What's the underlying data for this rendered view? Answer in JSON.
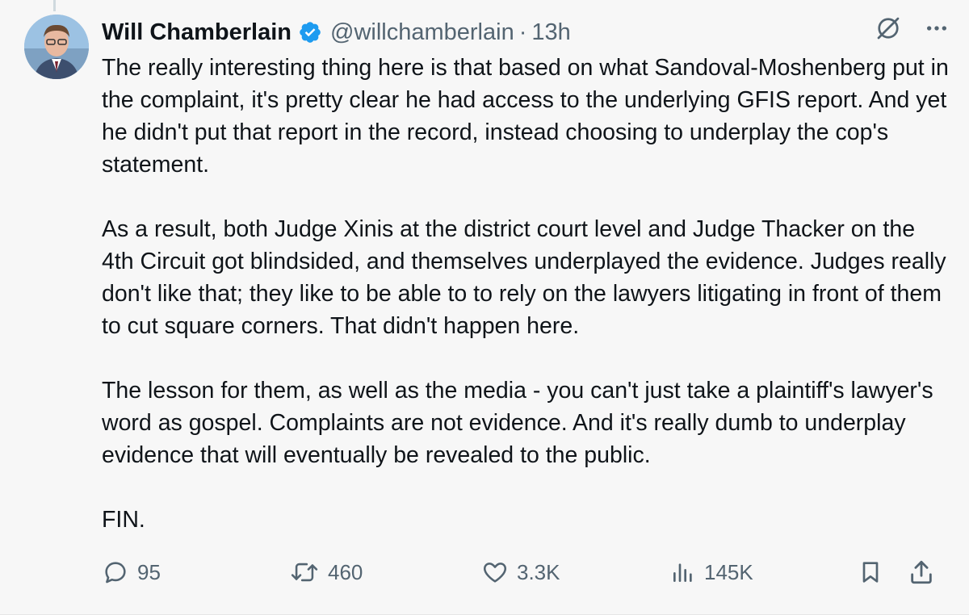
{
  "author": {
    "name": "Will Chamberlain",
    "handle": "@willchamberlain",
    "separator": "·",
    "time": "13h",
    "verified": true,
    "verified_color": "#1d9bf0"
  },
  "post": {
    "paragraphs": [
      "The really interesting thing here is that based on what Sandoval-Moshenberg put in the complaint, it's pretty clear he had access to the underlying GFIS report. And yet he didn't put that report in the record, instead choosing to underplay the cop's statement.",
      "As a result, both Judge Xinis at the district court level and Judge Thacker on the 4th Circuit got blindsided, and themselves underplayed the evidence. Judges really don't like that; they like to be able to to rely on the lawyers litigating in front of them to cut square corners. That didn't happen here.",
      "The lesson for them, as well as the media - you can't just take a plaintiff's lawyer's word as gospel. Complaints are not evidence. And it's really dumb to underplay evidence that will eventually be revealed to the public.",
      "FIN."
    ]
  },
  "actions": {
    "replies": "95",
    "reposts": "460",
    "likes": "3.3K",
    "views": "145K"
  },
  "icons": {
    "header": [
      "grok-icon",
      "more-icon"
    ],
    "actions": [
      "reply-icon",
      "repost-icon",
      "like-icon",
      "views-icon",
      "bookmark-icon",
      "share-icon"
    ]
  },
  "colors": {
    "background": "#f7f7f7",
    "text": "#0f1419",
    "secondary": "#536471",
    "brand": "#1d9bf0"
  }
}
